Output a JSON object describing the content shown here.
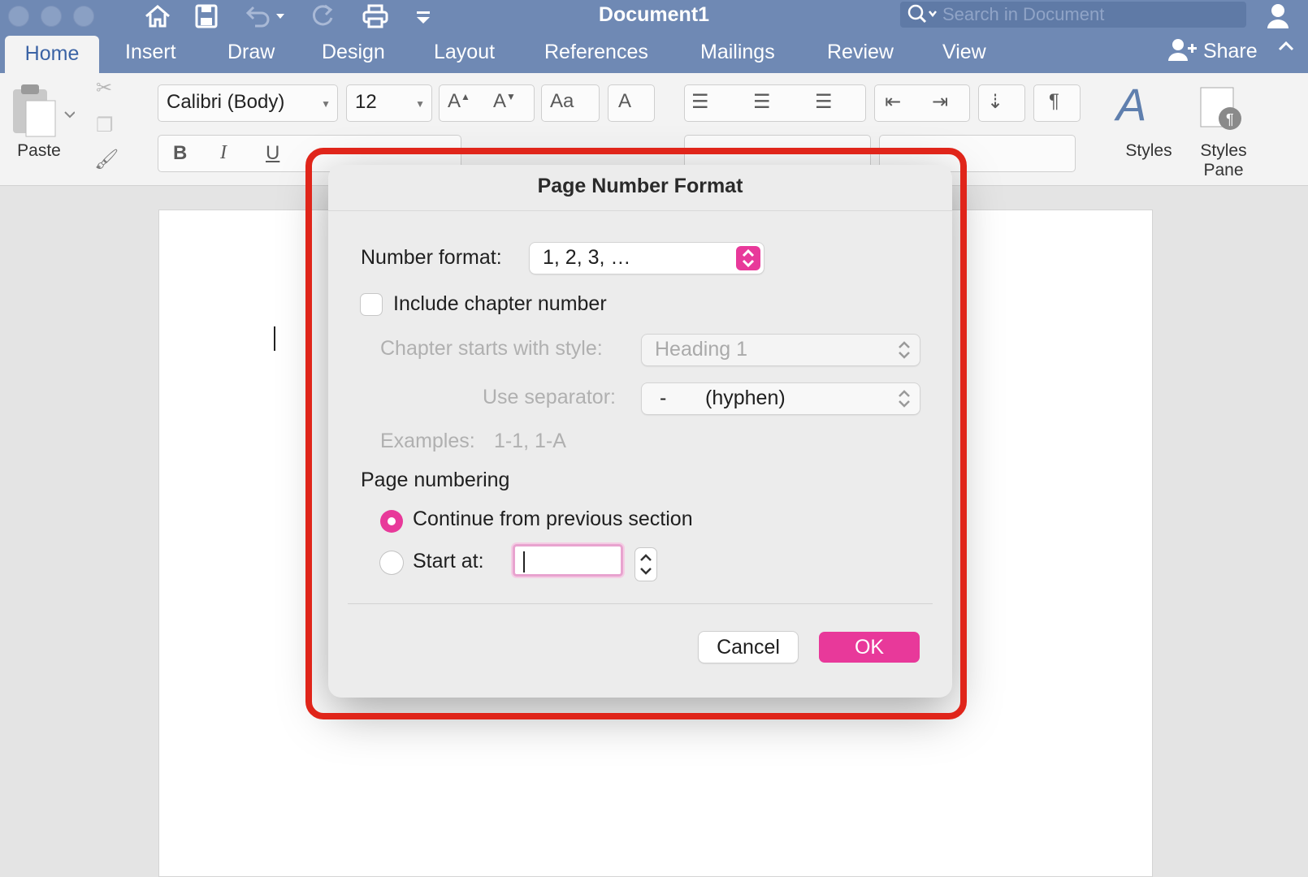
{
  "window": {
    "title": "Document1",
    "search_placeholder": "Search in Document"
  },
  "tabs": [
    {
      "label": "Home",
      "active": true
    },
    {
      "label": "Insert"
    },
    {
      "label": "Draw"
    },
    {
      "label": "Design"
    },
    {
      "label": "Layout"
    },
    {
      "label": "References"
    },
    {
      "label": "Mailings"
    },
    {
      "label": "Review"
    },
    {
      "label": "View"
    }
  ],
  "share_label": "Share",
  "toolbar": {
    "paste_label": "Paste",
    "font_name": "Calibri (Body)",
    "font_size": "12",
    "styles_label": "Styles",
    "styles_pane_label_1": "Styles",
    "styles_pane_label_2": "Pane"
  },
  "dialog": {
    "title": "Page Number Format",
    "number_format_label": "Number format:",
    "number_format_value": "1, 2, 3, …",
    "include_chapter_label": "Include chapter number",
    "include_chapter_checked": false,
    "chapter_style_label": "Chapter starts with style:",
    "chapter_style_value": "Heading 1",
    "separator_label": "Use separator:",
    "separator_char": "-",
    "separator_name": "(hyphen)",
    "examples_label": "Examples:",
    "examples_value": "1-1, 1-A",
    "page_numbering_label": "Page numbering",
    "continue_label": "Continue from previous section",
    "continue_selected": true,
    "start_at_label": "Start at:",
    "start_at_value": "",
    "cancel_label": "Cancel",
    "ok_label": "OK"
  },
  "colors": {
    "accent": "#e8399a",
    "titlebar": "#6f89b4",
    "highlight_frame": "#e0251a"
  }
}
